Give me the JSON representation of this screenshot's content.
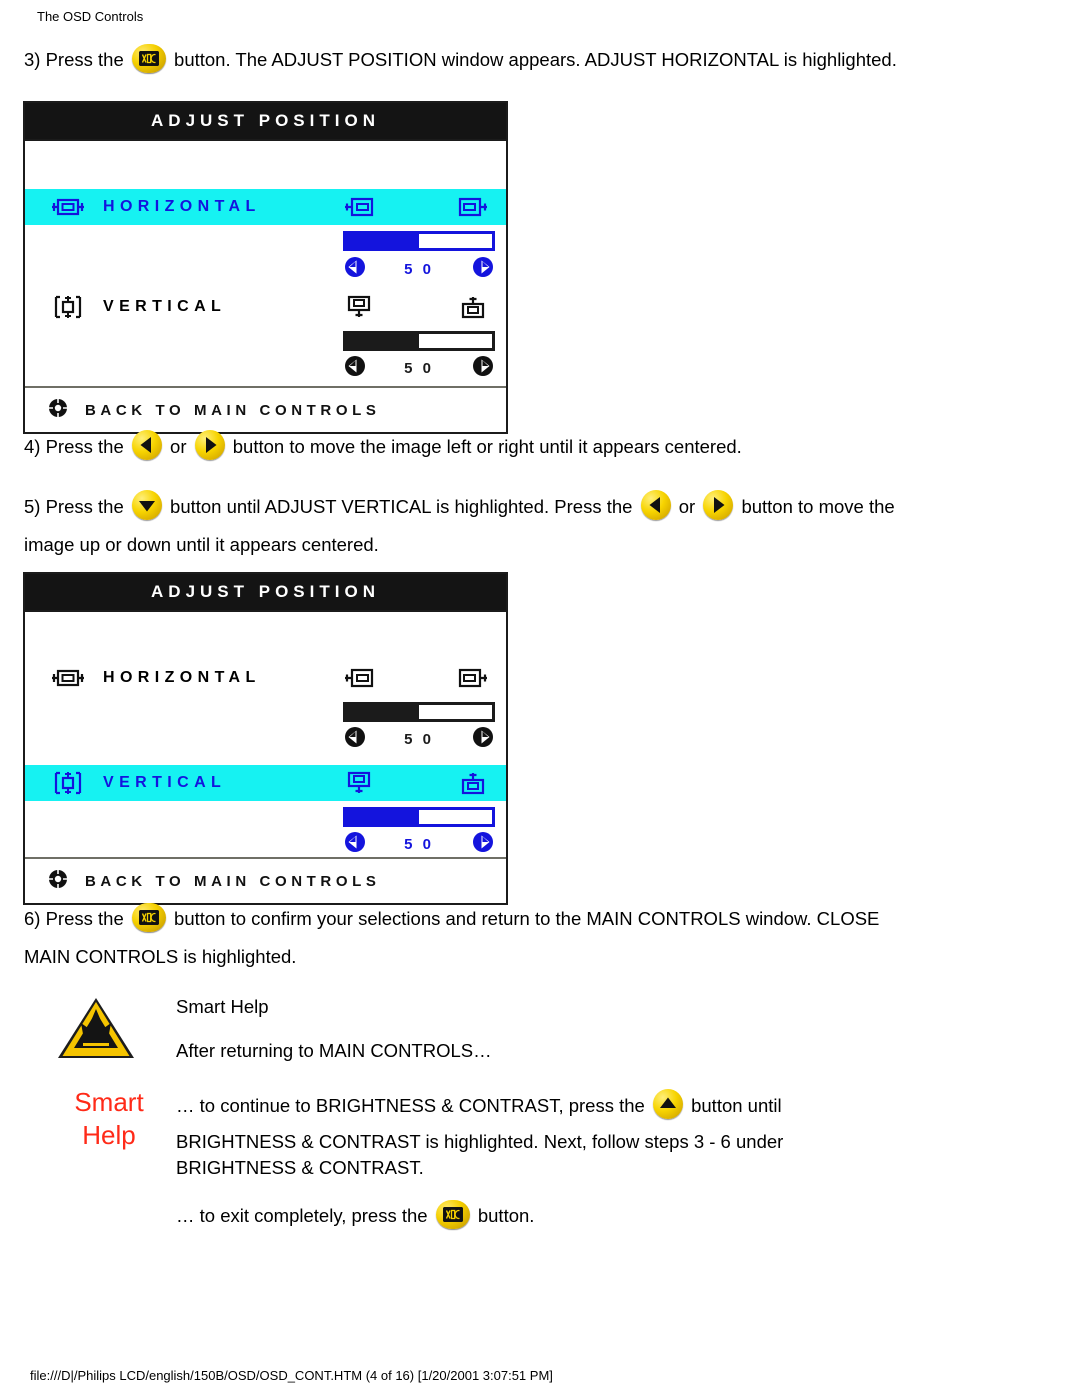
{
  "header": {
    "title": "The OSD Controls"
  },
  "footer": {
    "path": "file:///D|/Philips LCD/english/150B/OSD/OSD_CONT.HTM (4 of 16) [1/20/2001 3:07:51 PM]"
  },
  "colors": {
    "highlight": "#16f2f2",
    "highlight_text": "#1414dd",
    "osd_title_bg": "#141414",
    "button_yellow": "#f7d400",
    "smart_help_red": "#ff2a18"
  },
  "steps": {
    "step3": {
      "num": "3) Press the",
      "icon": "osd-button-icon",
      "rest": "button. The ADJUST POSITION window appears. ADJUST HORIZONTAL is highlighted."
    },
    "step4": {
      "num": "4) Press the",
      "icon_left": "left-arrow-button-icon",
      "mid": "or",
      "icon_right": "right-arrow-button-icon",
      "rest": "button to move the image left or right until it appears centered."
    },
    "step5": {
      "num": "5) Press the",
      "icon_down": "down-arrow-button-icon",
      "part1": "button until ADJUST VERTICAL is highlighted. Press the",
      "icon_left": "left-arrow-button-icon",
      "mid": "or",
      "icon_right": "right-arrow-button-icon",
      "part2": "button to move the",
      "line2": "image up or down until it appears centered."
    },
    "step6": {
      "num": "6) Press the",
      "icon": "osd-button-icon",
      "part1": "button to confirm your selections and return to the MAIN CONTROLS window. CLOSE",
      "line2": "MAIN CONTROLS is highlighted."
    }
  },
  "osd_panel_1": {
    "title": "A D J U S T   P O S I T I O N",
    "title_text": "ADJUST POSITION",
    "rows": [
      {
        "label": "HORIZONTAL",
        "icon": "horizontal-position-icon",
        "icon_left": "move-left-icon",
        "icon_right": "move-right-icon",
        "value": "5 0",
        "value_num": 50,
        "highlighted": true
      },
      {
        "label": "VERTICAL",
        "icon": "vertical-position-icon",
        "icon_left": "move-down-icon",
        "icon_right": "move-up-icon",
        "value": "5 0",
        "value_num": 50,
        "highlighted": false
      }
    ],
    "footer": {
      "label": "BACK TO MAIN CONTROLS",
      "icon": "back-icon"
    }
  },
  "osd_panel_2": {
    "title_text": "ADJUST POSITION",
    "rows": [
      {
        "label": "HORIZONTAL",
        "icon": "horizontal-position-icon",
        "icon_left": "move-left-icon",
        "icon_right": "move-right-icon",
        "value": "5 0",
        "value_num": 50,
        "highlighted": false
      },
      {
        "label": "VERTICAL",
        "icon": "vertical-position-icon",
        "icon_left": "move-down-icon",
        "icon_right": "move-up-icon",
        "value": "5 0",
        "value_num": 50,
        "highlighted": true
      }
    ],
    "footer": {
      "label": "BACK TO MAIN CONTROLS",
      "icon": "back-icon"
    }
  },
  "smart_help": {
    "warning_icon": "warning-triangle-icon",
    "title": "Smart Help",
    "badge_line1": "Smart",
    "badge_line2": "Help",
    "line_after": "After returning to MAIN CONTROLS…",
    "line_continue_a": "… to continue to BRIGHTNESS & CONTRAST, press the",
    "up_icon": "up-arrow-button-icon",
    "line_continue_b": "button until",
    "line_bright_1": "BRIGHTNESS & CONTRAST is highlighted. Next, follow steps 3 - 6 under",
    "line_bright_2": "BRIGHTNESS & CONTRAST.",
    "line_exit_a": "… to exit completely, press the",
    "exit_icon": "osd-button-icon",
    "line_exit_b": "button."
  }
}
